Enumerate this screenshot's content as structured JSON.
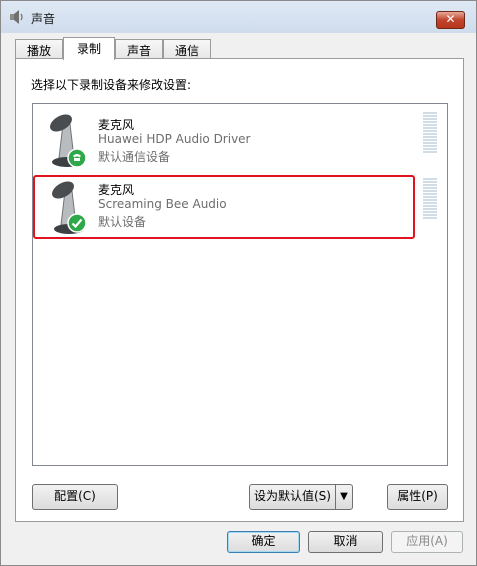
{
  "window": {
    "title": "声音",
    "close_glyph": "✕",
    "icon": "speaker-icon"
  },
  "tabs": [
    {
      "label": "播放"
    },
    {
      "label": "录制"
    },
    {
      "label": "声音"
    },
    {
      "label": "通信"
    }
  ],
  "active_tab": "录制",
  "instruction": "选择以下录制设备来修改设置:",
  "devices": [
    {
      "name": "麦克风",
      "driver": "Huawei HDP Audio Driver",
      "status": "默认通信设备",
      "badge": "phone-badge-icon",
      "selected": false
    },
    {
      "name": "麦克风",
      "driver": "Screaming Bee Audio",
      "status": "默认设备",
      "badge": "check-badge-icon",
      "selected": true
    }
  ],
  "buttons": {
    "configure": "配置(C)",
    "set_default": "设为默认值(S)",
    "set_default_arrow": "▼",
    "properties": "属性(P)",
    "ok": "确定",
    "cancel": "取消",
    "apply": "应用(A)"
  },
  "colors": {
    "selection_outline": "#e0141e",
    "badge_green": "#2fa84a",
    "meter_segment": "#d0dde6"
  }
}
